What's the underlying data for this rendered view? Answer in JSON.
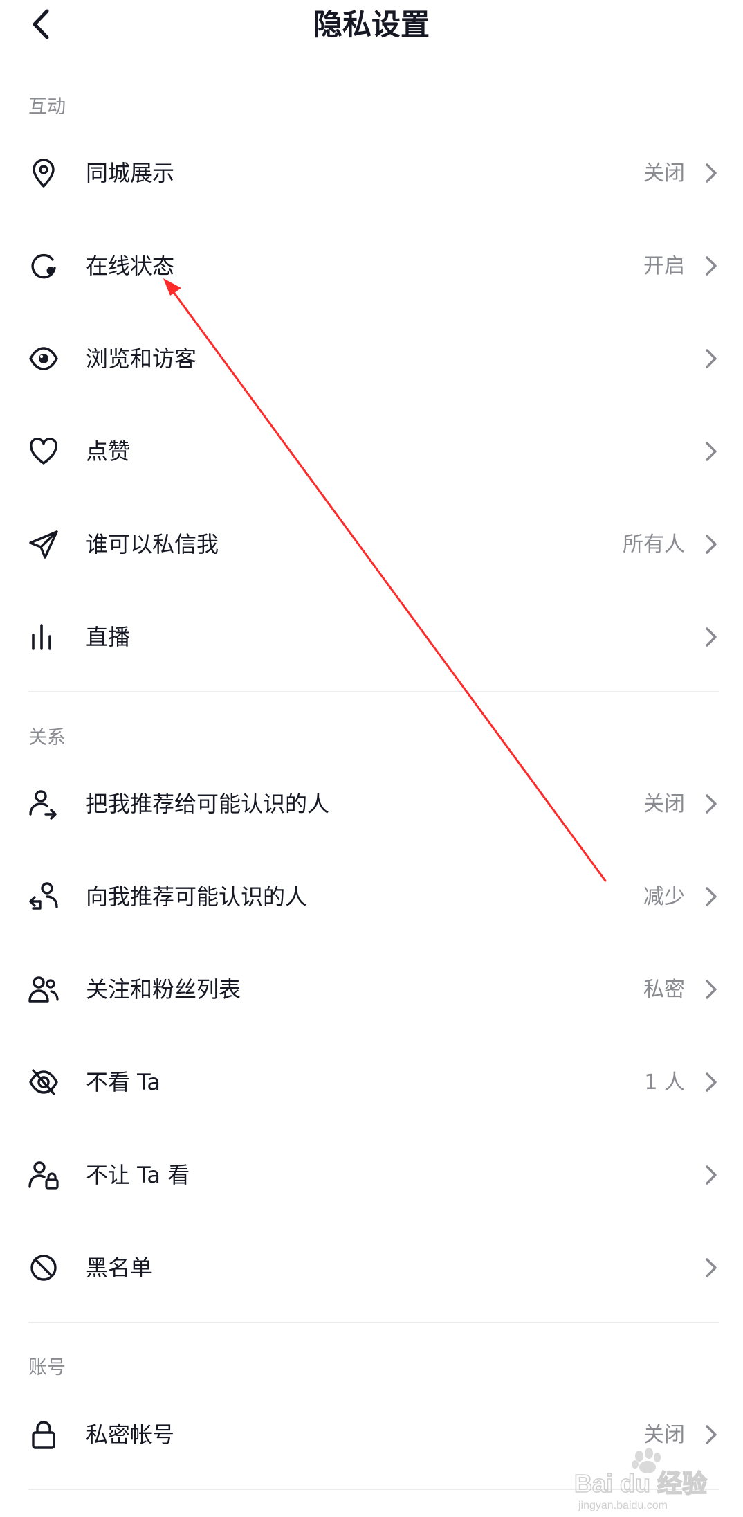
{
  "header": {
    "title": "隐私设置",
    "back_icon": "chevron-left-icon"
  },
  "sections": [
    {
      "label": "互动",
      "items": [
        {
          "icon": "location-pin-icon",
          "label": "同城展示",
          "value": "关闭"
        },
        {
          "icon": "online-status-icon",
          "label": "在线状态",
          "value": "开启"
        },
        {
          "icon": "eye-icon",
          "label": "浏览和访客",
          "value": ""
        },
        {
          "icon": "heart-icon",
          "label": "点赞",
          "value": ""
        },
        {
          "icon": "paper-plane-icon",
          "label": "谁可以私信我",
          "value": "所有人"
        },
        {
          "icon": "live-bars-icon",
          "label": "直播",
          "value": ""
        }
      ]
    },
    {
      "label": "关系",
      "items": [
        {
          "icon": "user-share-icon",
          "label": "把我推荐给可能认识的人",
          "value": "关闭"
        },
        {
          "icon": "user-recommend-icon",
          "label": "向我推荐可能认识的人",
          "value": "减少"
        },
        {
          "icon": "users-icon",
          "label": "关注和粉丝列表",
          "value": "私密"
        },
        {
          "icon": "eye-off-icon",
          "label": "不看 Ta",
          "value": "1 人"
        },
        {
          "icon": "user-lock-icon",
          "label": "不让 Ta 看",
          "value": ""
        },
        {
          "icon": "block-icon",
          "label": "黑名单",
          "value": ""
        }
      ]
    },
    {
      "label": "账号",
      "items": [
        {
          "icon": "lock-icon",
          "label": "私密帐号",
          "value": "关闭"
        }
      ]
    }
  ],
  "watermark": {
    "text": "Bai du 经验",
    "domain": "jingyan.baidu.com"
  },
  "colors": {
    "text": "#161823",
    "secondary": "#8a8b91",
    "divider": "#ececee",
    "annotation": "#ff2a2a"
  }
}
